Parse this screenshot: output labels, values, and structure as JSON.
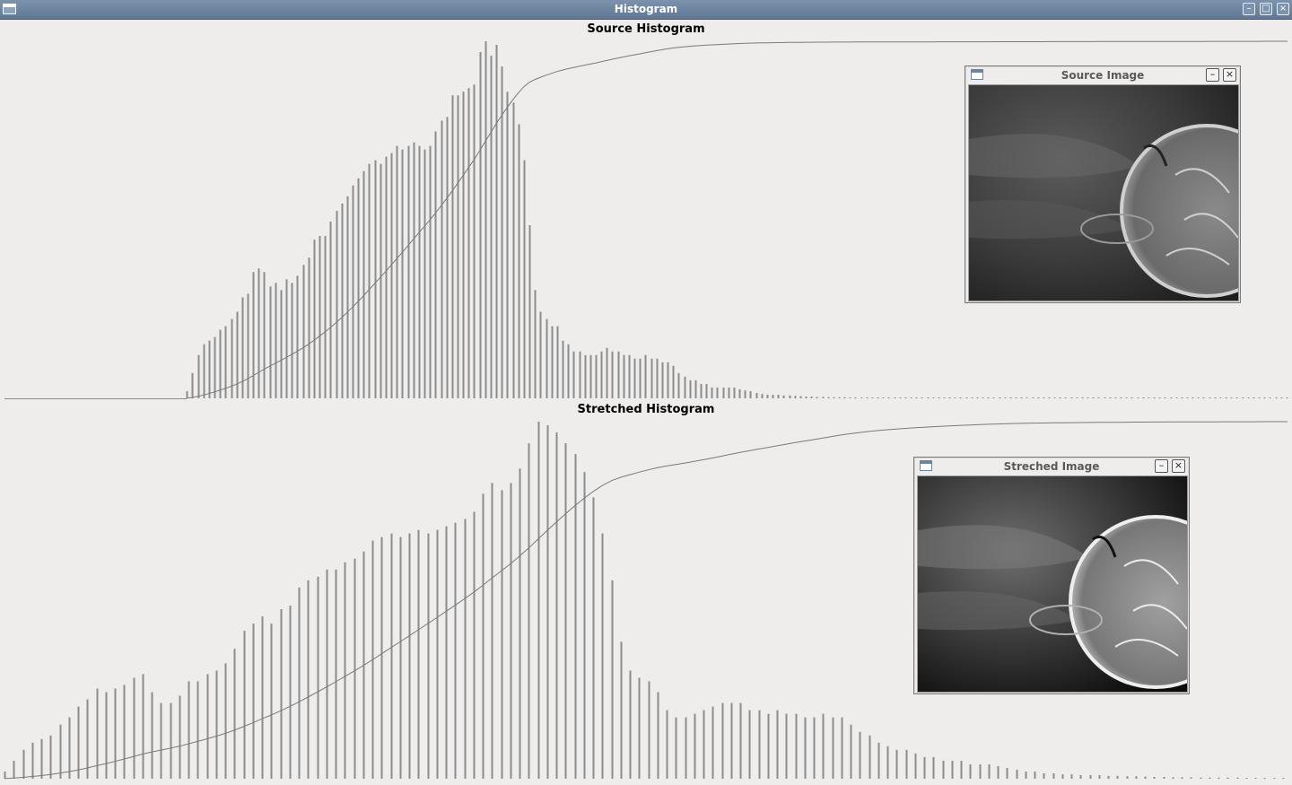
{
  "window": {
    "title": "Histogram"
  },
  "title_icons": {
    "menu": "window-menu-icon",
    "minimize": "minimize-icon",
    "maximize": "maximize-icon",
    "close": "close-icon"
  },
  "source_section": {
    "title": "Source Histogram"
  },
  "stretched_section": {
    "title": "Stretched Histogram"
  },
  "source_window": {
    "title": "Source Image",
    "image": "solar-flare-grayscale"
  },
  "stretched_window": {
    "title": "Streched Image",
    "image": "solar-flare-grayscale-stretched"
  },
  "colors": {
    "bar": "#8c8c8c",
    "curve": "#7a7a7a",
    "baseline": "#8c8c8c",
    "titlebar": "#6a819c",
    "background": "#eeedeb"
  },
  "chart_data": [
    {
      "type": "bar",
      "title": "Source Histogram",
      "values": [
        0,
        0,
        0,
        0,
        0,
        0,
        0,
        0,
        0,
        0,
        0,
        0,
        0,
        0,
        0,
        0,
        0,
        0,
        0,
        0,
        0,
        0,
        0,
        0,
        0,
        0,
        0,
        0,
        0,
        0,
        0,
        0,
        0,
        2,
        7,
        12,
        15,
        16,
        17,
        19,
        20,
        22,
        24,
        28,
        29,
        35,
        36,
        35,
        31,
        32,
        30,
        33,
        32,
        34,
        37,
        39,
        44,
        45,
        45,
        49,
        52,
        54,
        56,
        59,
        61,
        63,
        65,
        66,
        65,
        67,
        68,
        70,
        69,
        70,
        71,
        70,
        69,
        70,
        74,
        77,
        78,
        84,
        84,
        85,
        86,
        87,
        96,
        99,
        95,
        98,
        92,
        85,
        82,
        76,
        66,
        48,
        30,
        24,
        22,
        20,
        20,
        16,
        15,
        13,
        13,
        12,
        12,
        12,
        13,
        14,
        13,
        13,
        12,
        12,
        11,
        11,
        12,
        11,
        11,
        10,
        10,
        9,
        7,
        6,
        5,
        5,
        4,
        4,
        3,
        3,
        3,
        3,
        3,
        2.5,
        2.2,
        2,
        1.5,
        1.2,
        1,
        1,
        1,
        0.8,
        0.8,
        0.7,
        0.6,
        0.5,
        0.5,
        0.4,
        0.4,
        0.3,
        0.3,
        0.3,
        0.3,
        0.2,
        0.2,
        0.2,
        0.2,
        0.2,
        0.1,
        0.1,
        0.1,
        0.1,
        0.1,
        0.1,
        0.1,
        0.1,
        0.1,
        0.1,
        0.1,
        0.1,
        0.1,
        0.1,
        0.1,
        0.1,
        0.1,
        0.1,
        0.1,
        0.1,
        0.1,
        0.1,
        0.1,
        0.1,
        0.1,
        0.1,
        0.1,
        0.1,
        0.1,
        0.1,
        0.1,
        0.1,
        0.1,
        0.1,
        0.1,
        0.1,
        0.1,
        0.1,
        0.1,
        0.1,
        0.1,
        0.1,
        0.1,
        0.1,
        0.1,
        0.1,
        0.1,
        0.1,
        0.1,
        0.1,
        0.1,
        0.1,
        0.1,
        0.1,
        0.1,
        0.1,
        0.1,
        0.1,
        0.1,
        0.1,
        0.1,
        0.1,
        0.1,
        0.1,
        0.1,
        0.1,
        0.1,
        0.1,
        0.1,
        0.1,
        0.1,
        0.1,
        0.1,
        0.1,
        0.1
      ],
      "cumulative_shown": true
    },
    {
      "type": "bar",
      "title": "Stretched Histogram",
      "values": [
        2,
        5,
        8,
        10,
        11,
        12,
        15,
        17,
        20,
        22,
        25,
        24,
        25,
        26,
        28,
        29,
        24,
        21,
        21,
        23,
        27,
        27,
        29,
        30,
        32,
        36,
        41,
        43,
        45,
        43,
        47,
        48,
        53,
        55,
        56,
        58,
        58,
        60,
        61,
        63,
        66,
        67,
        68,
        67,
        68,
        69,
        68,
        69,
        70,
        71,
        72,
        74,
        79,
        82,
        80,
        82,
        86,
        93,
        99,
        98,
        96,
        93,
        90,
        85,
        78,
        68,
        55,
        38,
        30,
        28,
        27,
        24,
        19,
        17,
        17,
        18,
        19,
        20,
        21,
        21,
        21,
        19,
        19,
        18,
        19,
        18,
        18,
        17,
        17,
        18,
        17,
        17,
        15,
        13,
        12,
        10,
        9,
        8,
        8,
        7,
        6,
        6,
        5,
        5,
        5,
        4,
        4,
        4,
        3.5,
        3,
        2.5,
        2,
        2,
        1.5,
        1.5,
        1.2,
        1.2,
        1,
        1,
        1,
        0.8,
        0.8,
        0.7,
        0.7,
        0.6,
        0.5,
        0.5,
        0.4,
        0.4,
        0.4,
        0.3,
        0.3,
        0.3,
        0.3,
        0.3,
        0.2,
        0.2,
        0.2,
        0.2,
        0.2
      ],
      "cumulative_shown": true
    }
  ]
}
